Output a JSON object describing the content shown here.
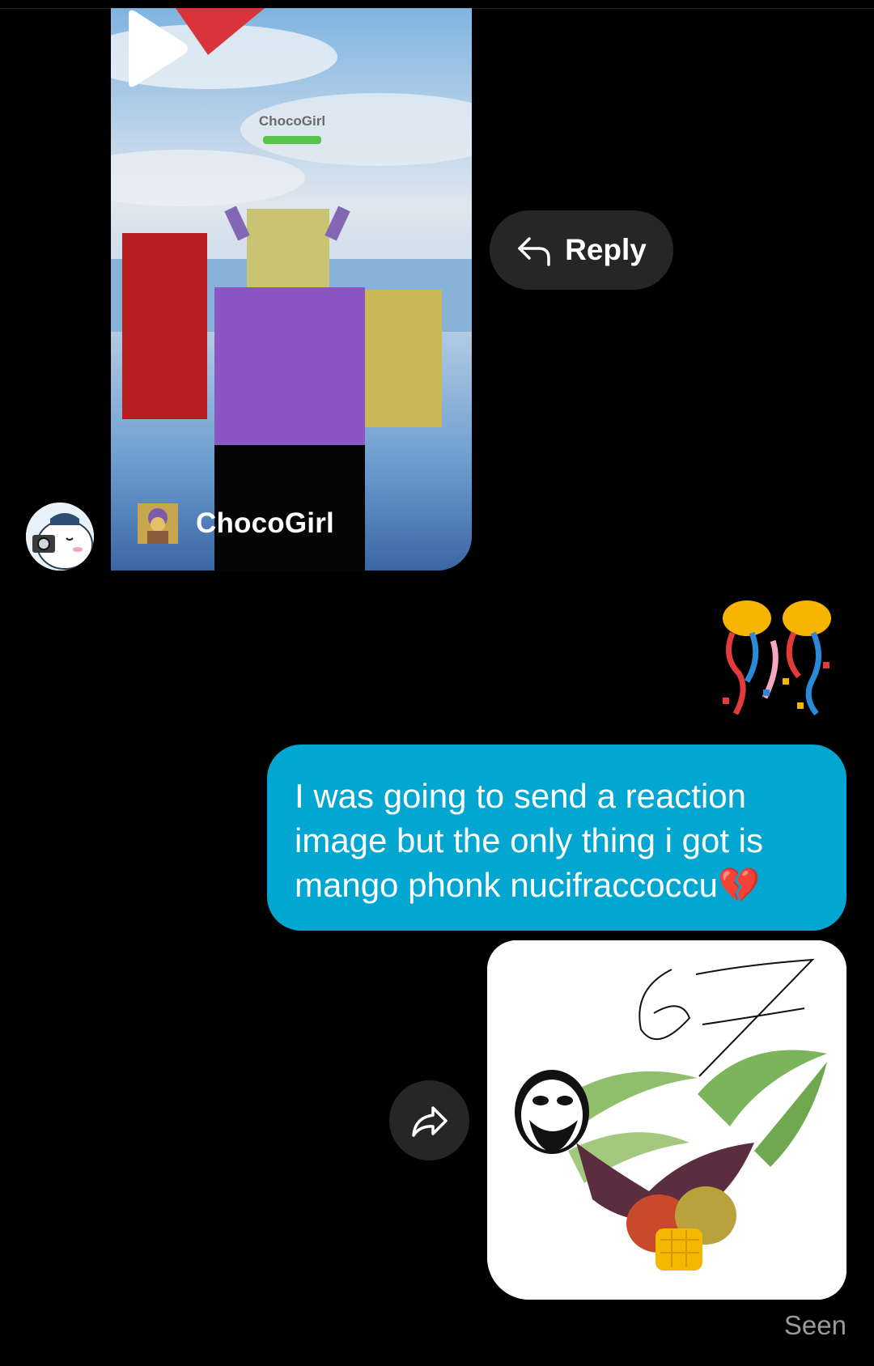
{
  "shared_reel": {
    "owner_name": "ChocoGirl",
    "in_video_tag": "ChocoGirl"
  },
  "actions": {
    "reply_label": "Reply"
  },
  "messages": {
    "text": "I was going to send a reaction image but the only thing i got is mango phonk nucifraccoccu💔",
    "image_caption": "67"
  },
  "status": {
    "seen": "Seen"
  },
  "colors": {
    "background": "#000000",
    "bubble": "#01a6d1",
    "button": "#262626"
  }
}
